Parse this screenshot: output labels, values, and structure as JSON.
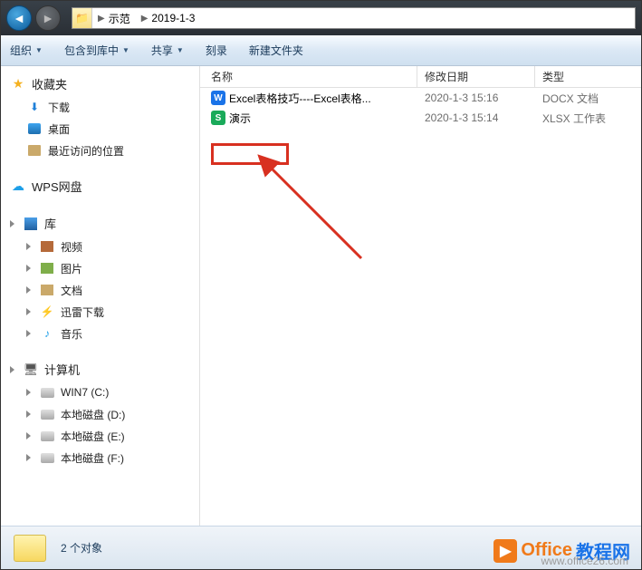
{
  "breadcrumb": {
    "seg1": "示范",
    "seg2": "2019-1-3"
  },
  "toolbar": {
    "organize": "组织",
    "include": "包含到库中",
    "share": "共享",
    "burn": "刻录",
    "newfolder": "新建文件夹"
  },
  "nav": {
    "favorites": "收藏夹",
    "downloads": "下载",
    "desktop": "桌面",
    "recent": "最近访问的位置",
    "wps": "WPS网盘",
    "libraries": "库",
    "videos": "视频",
    "pictures": "图片",
    "documents": "文档",
    "thunder": "迅雷下载",
    "music": "音乐",
    "computer": "计算机",
    "win7": "WIN7 (C:)",
    "diskD": "本地磁盘 (D:)",
    "diskE": "本地磁盘 (E:)",
    "diskF": "本地磁盘 (F:)"
  },
  "columns": {
    "name": "名称",
    "date": "修改日期",
    "type": "类型"
  },
  "files": [
    {
      "name": "Excel表格技巧----Excel表格...",
      "date": "2020-1-3 15:16",
      "type": "DOCX 文档",
      "icon": "W"
    },
    {
      "name": "演示",
      "date": "2020-1-3 15:14",
      "type": "XLSX 工作表",
      "icon": "S"
    }
  ],
  "status": "2 个对象",
  "watermark": {
    "brand_a": "Office",
    "brand_b": "教程网",
    "url": "www.office26.com",
    "colors": {
      "a": "#f07a1a",
      "b": "#1a73e8",
      "url": "#9a9a9a"
    }
  }
}
